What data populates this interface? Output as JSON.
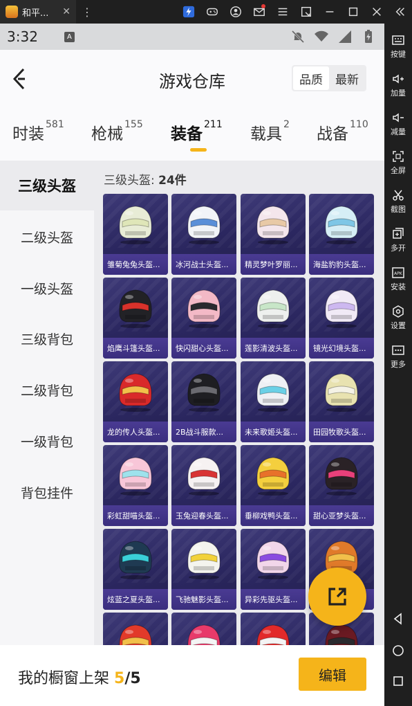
{
  "emulator": {
    "tab_title": "和平...",
    "sidebar": [
      {
        "label": "按键",
        "icon": "keyboard-icon"
      },
      {
        "label": "加量",
        "icon": "volume-up-icon"
      },
      {
        "label": "减量",
        "icon": "volume-down-icon"
      },
      {
        "label": "全屏",
        "icon": "fullscreen-icon"
      },
      {
        "label": "截图",
        "icon": "scissors-icon"
      },
      {
        "label": "多开",
        "icon": "multi-instance-icon"
      },
      {
        "label": "安装",
        "icon": "apk-icon"
      },
      {
        "label": "设置",
        "icon": "gear-icon"
      },
      {
        "label": "更多",
        "icon": "more-icon"
      }
    ]
  },
  "status": {
    "time": "3:32",
    "badge": "A"
  },
  "header": {
    "title": "游戏仓库",
    "sort_options": [
      "品质",
      "最新"
    ],
    "sort_selected": "品质"
  },
  "tabs": [
    {
      "label": "时装",
      "count": "581"
    },
    {
      "label": "枪械",
      "count": "155"
    },
    {
      "label": "装备",
      "count": "211",
      "active": true
    },
    {
      "label": "载具",
      "count": "2"
    },
    {
      "label": "战备",
      "count": "110"
    }
  ],
  "left_nav": [
    "三级头盔",
    "二级头盔",
    "一级头盔",
    "三级背包",
    "二级背包",
    "一级背包",
    "背包挂件"
  ],
  "section": {
    "label": "三级头盔:",
    "count": "24件"
  },
  "items": [
    {
      "name": "雏菊兔兔头盔...",
      "color": "#e8ecd6",
      "accent": "#dfe6b8"
    },
    {
      "name": "冰河战士头盔...",
      "color": "#f2f4f8",
      "accent": "#5a8fd8"
    },
    {
      "name": "精灵梦叶罗丽...",
      "color": "#f4e6ec",
      "accent": "#e8c9a6"
    },
    {
      "name": "海盐豹豹头盔...",
      "color": "#d6eef6",
      "accent": "#7ec6e6"
    },
    {
      "name": "焰鹰斗篷头盔...",
      "color": "#222226",
      "accent": "#d8322b"
    },
    {
      "name": "快闪甜心头盔...",
      "color": "#f3b9c6",
      "accent": "#2a2a2e"
    },
    {
      "name": "莲影清波头盔...",
      "color": "#eef0ee",
      "accent": "#c8e6c8"
    },
    {
      "name": "镜光幻境头盔...",
      "color": "#f1eaf6",
      "accent": "#cdb8f0"
    },
    {
      "name": "龙的传人头盔...",
      "color": "#d92a2a",
      "accent": "#f2c04a"
    },
    {
      "name": "2B战斗服款...",
      "color": "#1e1e22",
      "accent": "#6a6a70"
    },
    {
      "name": "未来歌姬头盔...",
      "color": "#eef0f4",
      "accent": "#6ad0e6"
    },
    {
      "name": "田园牧歌头盔...",
      "color": "#e8e2b0",
      "accent": "#f4f2e6"
    },
    {
      "name": "彩虹甜喵头盔...",
      "color": "#f8c6d8",
      "accent": "#9ee2ec"
    },
    {
      "name": "玉兔迎春头盔...",
      "color": "#f6f2f2",
      "accent": "#d83434"
    },
    {
      "name": "垂柳戏鸭头盔...",
      "color": "#f4cf3e",
      "accent": "#e8712a"
    },
    {
      "name": "甜心亚梦头盔...",
      "color": "#2a2226",
      "accent": "#e8407a"
    },
    {
      "name": "炫蓝之夏头盔...",
      "color": "#1f3a52",
      "accent": "#3ad0d8"
    },
    {
      "name": "飞驰魅影头盔...",
      "color": "#f4f4ee",
      "accent": "#f2d23a"
    },
    {
      "name": "异彩先驱头盔...",
      "color": "#f2d6ea",
      "accent": "#8a4ae0"
    },
    {
      "name": "",
      "color": "#e07a2a",
      "accent": "#f2c04a"
    },
    {
      "name": "",
      "color": "#e23a2a",
      "accent": "#f2c04a"
    },
    {
      "name": "",
      "color": "#e83a6a",
      "accent": "#f4f4f4"
    },
    {
      "name": "",
      "color": "#e22a2a",
      "accent": "#f4f4f4"
    },
    {
      "name": "",
      "color": "#6a1a22",
      "accent": "#2a2a2e"
    }
  ],
  "bottom": {
    "label": "我的橱窗上架",
    "current": "5",
    "separator": "/",
    "total": "5",
    "edit": "编辑"
  },
  "colors": {
    "accent": "#f5b41a",
    "card_bg": "#2b2760",
    "card_label": "#3a2e7e"
  }
}
